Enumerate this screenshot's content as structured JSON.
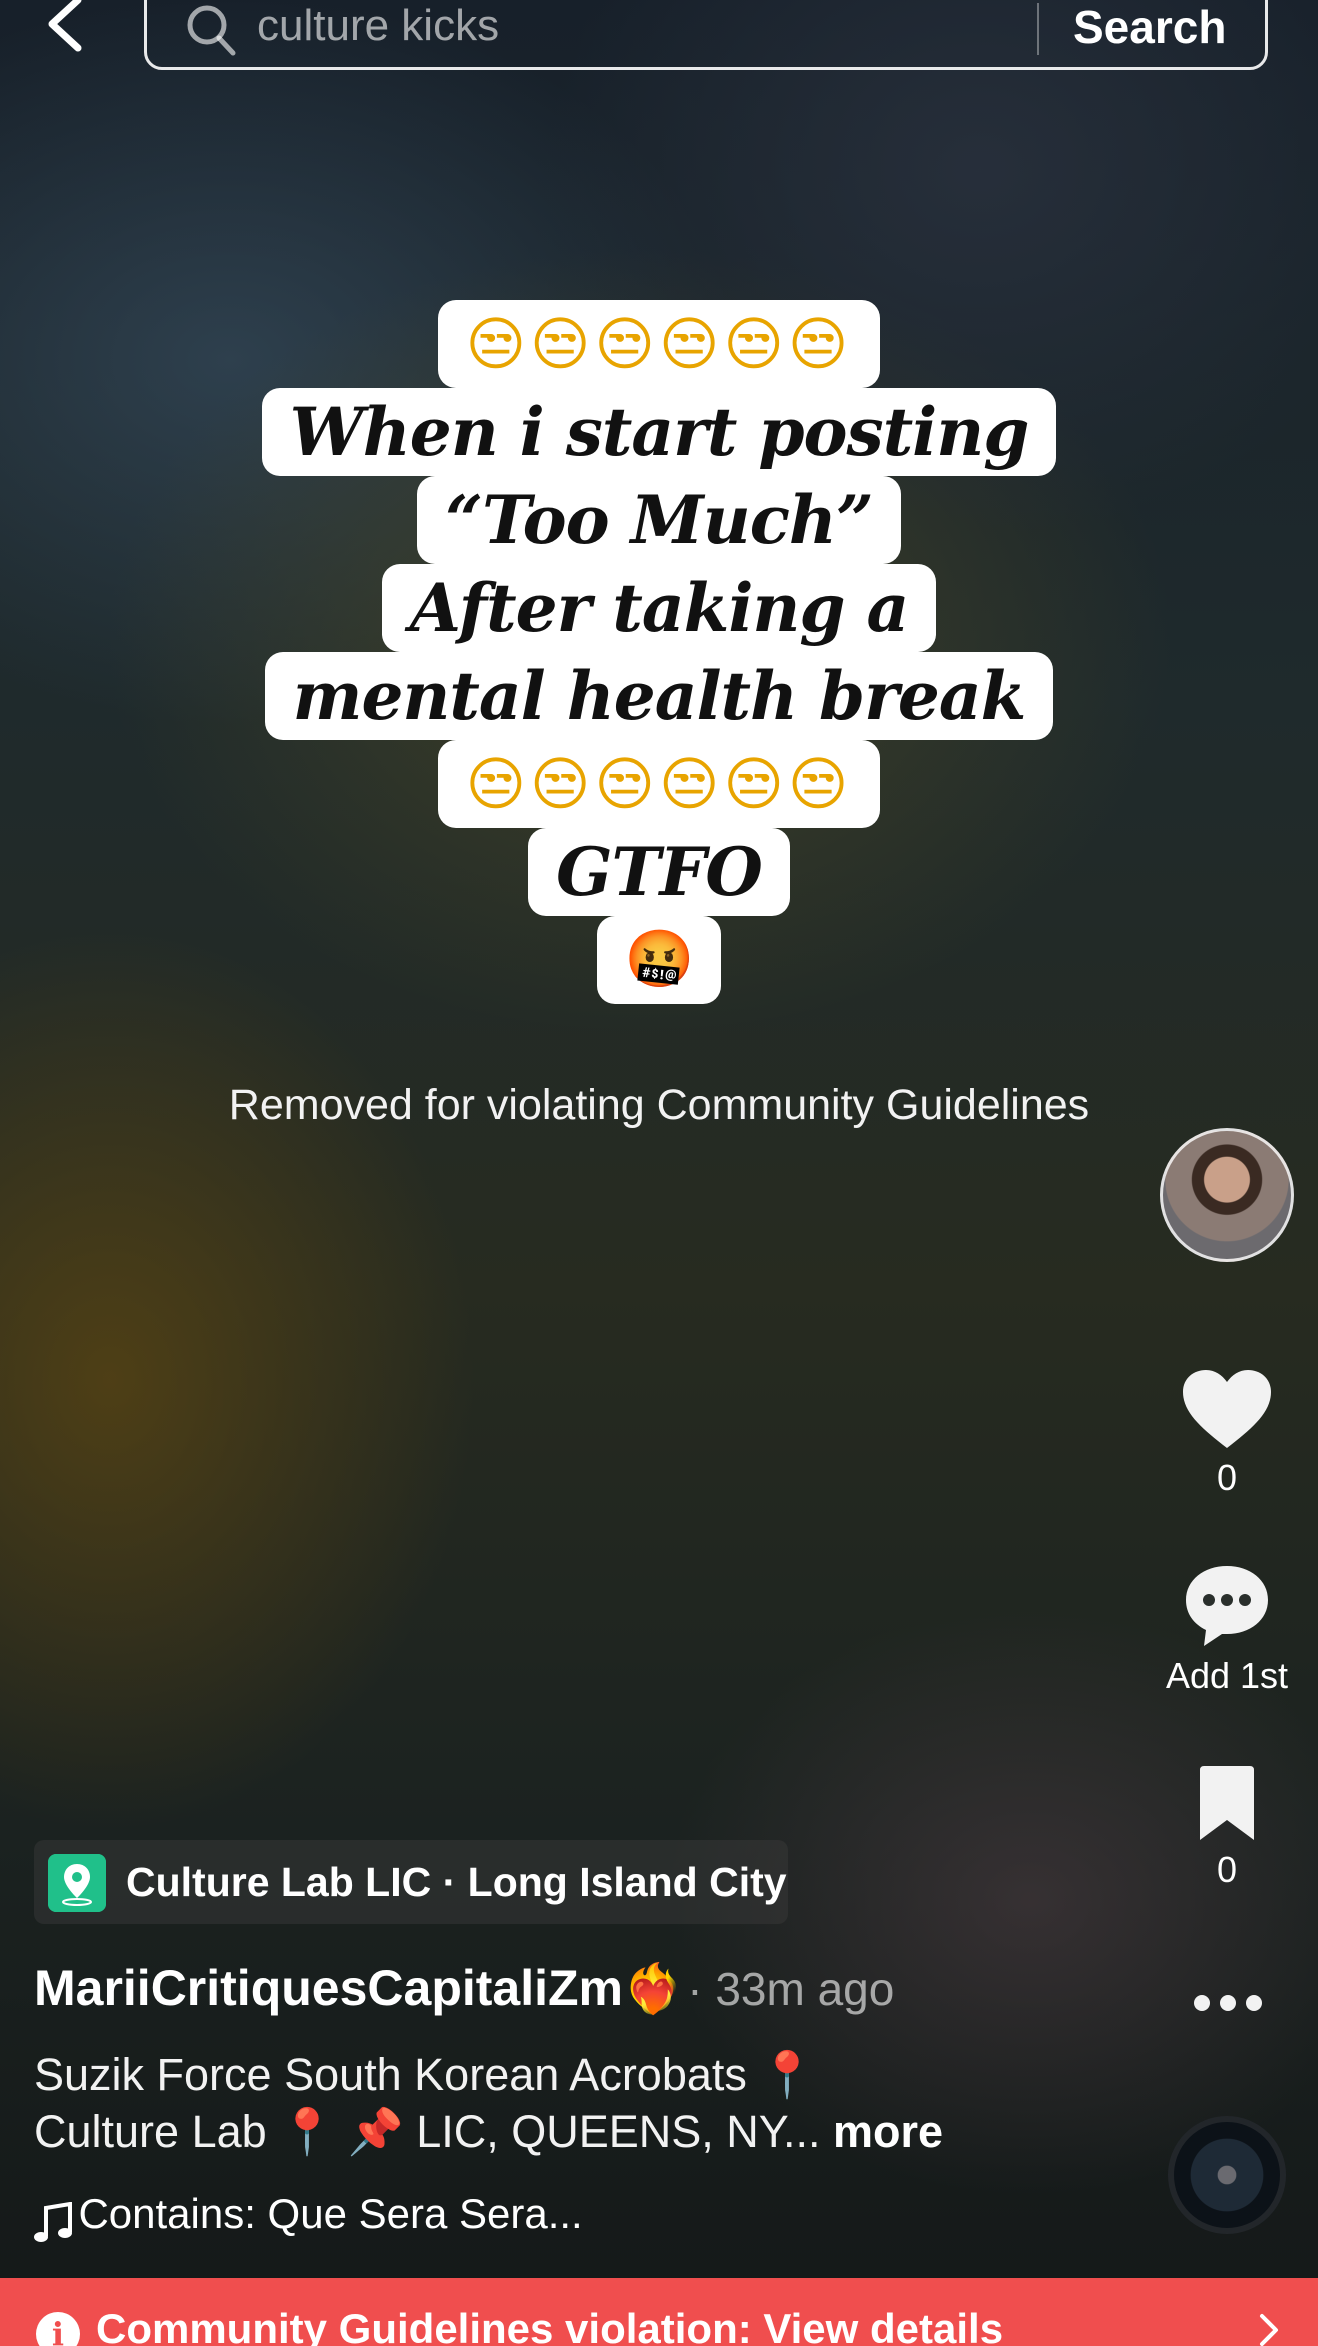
{
  "search": {
    "query": "culture kicks",
    "button_label": "Search"
  },
  "overlay": {
    "lines": [
      "😒😒😒😒😒😒",
      "When i start posting",
      "“Too Much”",
      "After taking a",
      "mental health break",
      "😒😒😒😒😒😒",
      "GTFO",
      "🤬"
    ]
  },
  "removed_message": "Removed for violating Community Guidelines",
  "actions": {
    "likes": "0",
    "comments": "Add 1st",
    "saves": "0"
  },
  "location": {
    "label": "Culture Lab LIC · Long Island City"
  },
  "author": {
    "name": "MariiCritiquesCapitaliZm",
    "emoji": "❤️‍🔥",
    "time": "· 33m ago"
  },
  "caption": {
    "line1": "Suzik Force South Korean Acrobats 📍",
    "line2": "Culture Lab 📍  📌 LIC, QUEENS, NY...",
    "more": "more"
  },
  "music": {
    "icon": "music-note-icon",
    "text": "Contains: Que Sera Sera..."
  },
  "violation": {
    "text": "Community Guidelines violation: View details"
  },
  "colors": {
    "violation_bar": "#f04e4e",
    "location_icon": "#20c08a"
  }
}
